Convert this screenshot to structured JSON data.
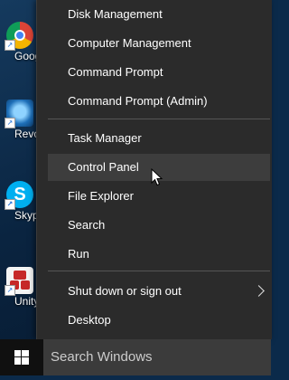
{
  "desktop": {
    "icons": [
      {
        "name": "chrome",
        "label": "Google Chrome"
      },
      {
        "name": "revo",
        "label": "Revo Uninstaller"
      },
      {
        "name": "skype",
        "label": "Skype"
      },
      {
        "name": "unity",
        "label": "Unity"
      }
    ]
  },
  "context_menu": {
    "items": [
      {
        "label": "Disk Management"
      },
      {
        "label": "Computer Management"
      },
      {
        "label": "Command Prompt"
      },
      {
        "label": "Command Prompt (Admin)"
      },
      {
        "label": "Task Manager"
      },
      {
        "label": "Control Panel"
      },
      {
        "label": "File Explorer"
      },
      {
        "label": "Search"
      },
      {
        "label": "Run"
      },
      {
        "label": "Shut down or sign out"
      },
      {
        "label": "Desktop"
      }
    ],
    "hovered": "Control Panel"
  },
  "taskbar": {
    "search_placeholder": "Search Windows"
  }
}
